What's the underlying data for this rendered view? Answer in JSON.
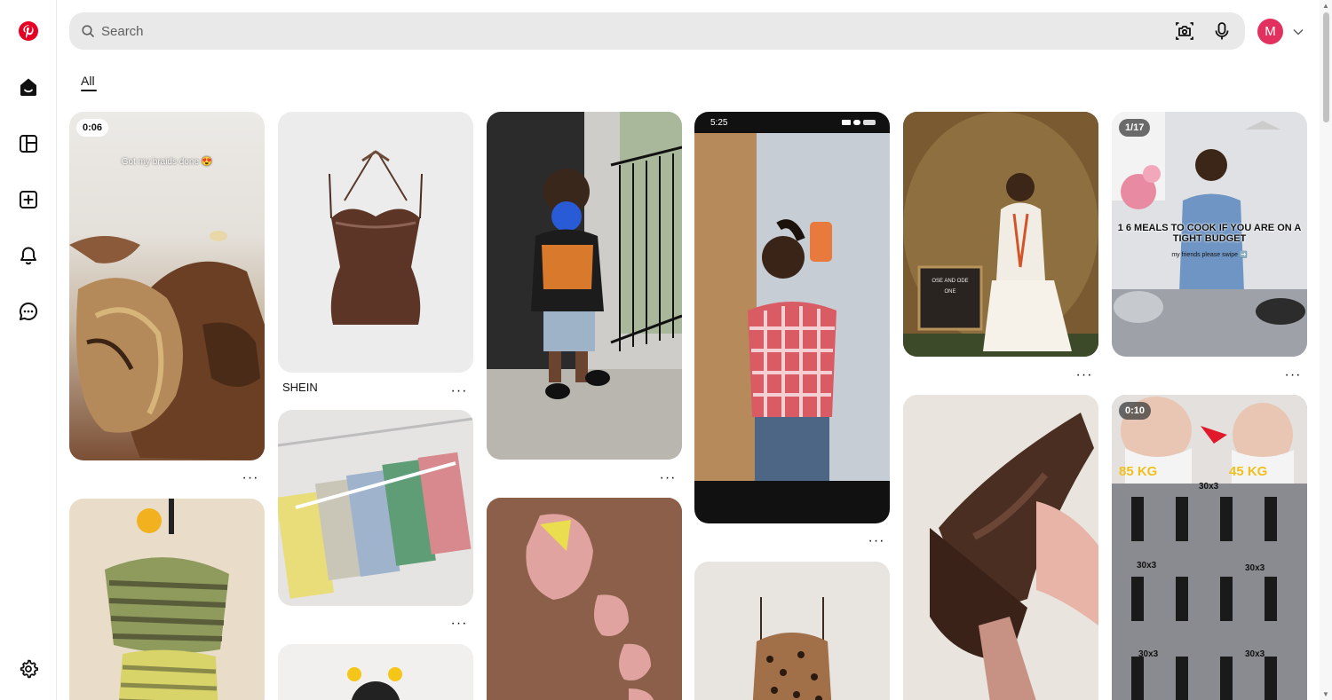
{
  "app": {
    "brand_color": "#e60023",
    "avatar_color": "#e3315f"
  },
  "sidebar": {
    "items": [
      {
        "name": "pinterest-logo-icon"
      },
      {
        "name": "home-icon"
      },
      {
        "name": "boards-icon"
      },
      {
        "name": "create-icon"
      },
      {
        "name": "notifications-icon"
      },
      {
        "name": "messages-icon"
      },
      {
        "name": "settings-icon"
      }
    ]
  },
  "header": {
    "search_placeholder": "Search",
    "avatar_letter": "M"
  },
  "tabs": {
    "all": "All"
  },
  "pins": [
    {
      "badge": "0:06",
      "caption": "Got my braids done 😍"
    },
    {
      "title": "SHEIN"
    },
    {
      "caption": ""
    },
    {
      "status_time": "5:25"
    },
    {
      "letterboard": "OSE AND ODE ONE"
    },
    {
      "badge": "1/17",
      "headline": "1 6 MEALS TO COOK IF YOU ARE ON A TIGHT BUDGET",
      "subline": "my friends please swipe ➡️"
    },
    {
      "badge": "0:10",
      "left_weight": "85 KG",
      "right_weight": "45 KG",
      "reps": [
        "30x3",
        "30x3",
        "30x3",
        "30x3",
        "30x3"
      ]
    }
  ],
  "more_label": "···"
}
